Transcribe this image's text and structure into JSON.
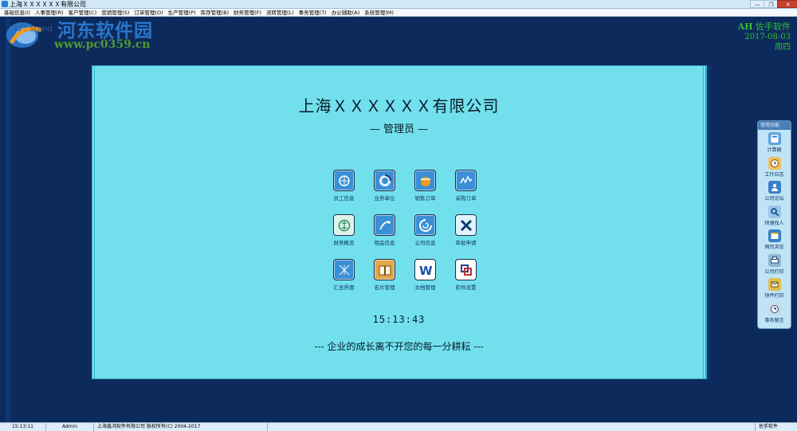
{
  "window": {
    "title": "上海ＸＸＸＸＸＸ有限公司",
    "controls": [
      "—",
      "❐",
      "✕"
    ]
  },
  "menu": [
    "基础信息(I)",
    "人事管理(R)",
    "客户管理(C)",
    "营销管理(S)",
    "订单管理(O)",
    "生产管理(P)",
    "库存管理(B)",
    "财务管理(F)",
    "流转管理(L)",
    "事务管理(T)",
    "办公辅助(A)",
    "系统管理(M)"
  ],
  "watermark": {
    "text": "河东软件园",
    "url": "www.pc0359.cn",
    "hint": "id : Stand"
  },
  "brand": {
    "ah": "AH",
    "name": "佐手软件",
    "date": "2017-08-03",
    "weekday": "周四"
  },
  "main": {
    "company": "上海ＸＸＸＸＸＸ有限公司",
    "role": "— 管理员 —",
    "clock": "15:13:43",
    "slogan": "--- 企业的成长离不开您的每一分耕耘 ---",
    "tiles": [
      {
        "label": "员工信息",
        "icon": "employee-icon",
        "bg": "#3a8fd6"
      },
      {
        "label": "业务单位",
        "icon": "business-unit-icon",
        "bg": "#3a8fd6"
      },
      {
        "label": "销售订单",
        "icon": "sales-order-icon",
        "bg": "#3a8fd6"
      },
      {
        "label": "采购订单",
        "icon": "purchase-order-icon",
        "bg": "#3a8fd6"
      },
      {
        "label": "财务概览",
        "icon": "finance-icon",
        "bg": "#dff2ea"
      },
      {
        "label": "物品信息",
        "icon": "item-info-icon",
        "bg": "#3a8fd6"
      },
      {
        "label": "公司信息",
        "icon": "company-info-icon",
        "bg": "#3a8fd6"
      },
      {
        "label": "审批申请",
        "icon": "approval-icon",
        "bg": "#dff3fb"
      },
      {
        "label": "汇总界面",
        "icon": "summary-icon",
        "bg": "#3a8fd6"
      },
      {
        "label": "名片管理",
        "icon": "card-manage-icon",
        "bg": "#e0a84a"
      },
      {
        "label": "文档管理",
        "icon": "document-icon",
        "bg": "#ffffff"
      },
      {
        "label": "软件设置",
        "icon": "settings-icon",
        "bg": "#ffffff"
      }
    ]
  },
  "quick_panel": {
    "title": "常用功能",
    "items": [
      {
        "label": "计算器",
        "icon": "calculator-icon",
        "bg": "#5fa3e0"
      },
      {
        "label": "工作日志",
        "icon": "work-log-icon",
        "bg": "#f0c060"
      },
      {
        "label": "公司论坛",
        "icon": "forum-icon",
        "bg": "#3a80c8"
      },
      {
        "label": "快速找人",
        "icon": "find-person-icon",
        "bg": "#9ac6ea"
      },
      {
        "label": "网页浏览",
        "icon": "browser-icon",
        "bg": "#3a80c8"
      },
      {
        "label": "公司打印",
        "icon": "printer-icon",
        "bg": "#8fb6d8"
      },
      {
        "label": "快件打印",
        "icon": "express-print-icon",
        "bg": "#e0c050"
      },
      {
        "label": "事务留言",
        "icon": "message-icon",
        "bg": "#c8dbe8"
      }
    ]
  },
  "status": {
    "time": "15:13:11",
    "user": "Admin",
    "copyright": "上海鑫鸿软件有限公司 版权所有(C) 2004-2017",
    "right": "佐手软件"
  },
  "colors": {
    "background": "#0c2a5c",
    "panel": "#71e0ec",
    "brand": "#2fbf2f"
  }
}
